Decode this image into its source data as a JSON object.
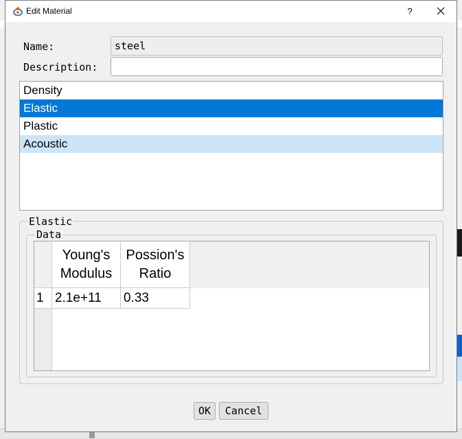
{
  "window": {
    "title": "Edit Material",
    "help_label": "?"
  },
  "form": {
    "name_label": "Name:",
    "name_value": "steel",
    "description_label": "Description:",
    "description_value": ""
  },
  "properties": {
    "items": [
      {
        "label": "Density",
        "state": "normal"
      },
      {
        "label": "Elastic",
        "state": "selected"
      },
      {
        "label": "Plastic",
        "state": "normal"
      },
      {
        "label": "Acoustic",
        "state": "hover"
      }
    ]
  },
  "elastic_group": {
    "title": "Elastic",
    "data_group_title": "Data",
    "table": {
      "columns": [
        "Young's\nModulus",
        "Possion's\nRatio"
      ],
      "rows": [
        {
          "index": "1",
          "cells": [
            "2.1e+11",
            "0.33"
          ]
        }
      ]
    }
  },
  "buttons": {
    "ok_label": "OK",
    "cancel_label": "Cancel"
  },
  "colors": {
    "selection": "#0078d7",
    "hover": "#cce4f7"
  }
}
